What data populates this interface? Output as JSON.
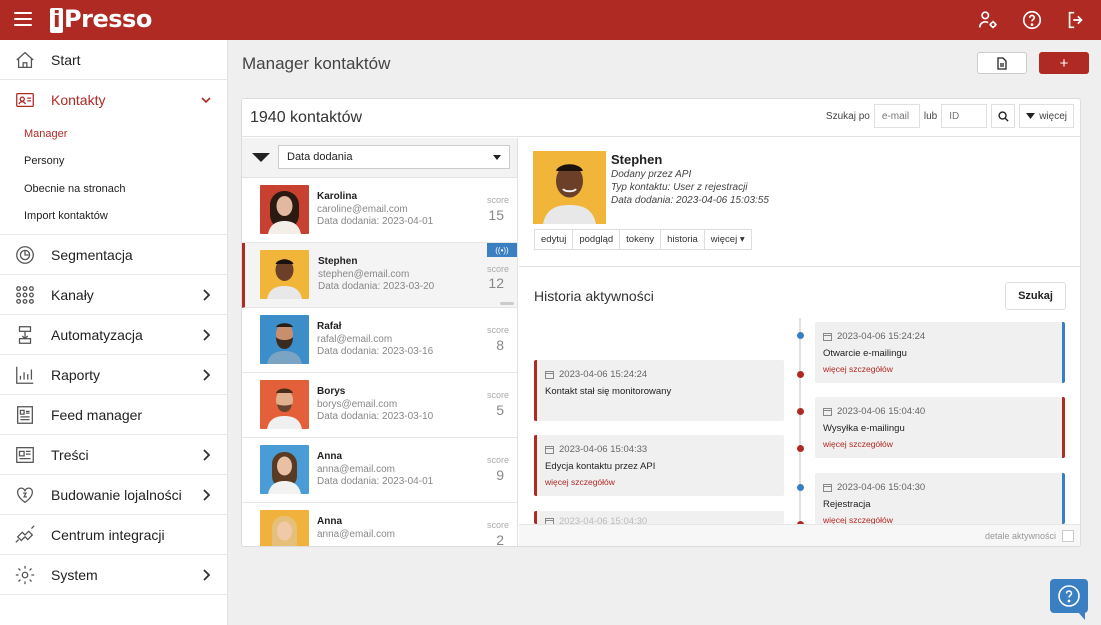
{
  "app": {
    "logo_i": "i",
    "logo_rest": "Presso"
  },
  "colors": {
    "brand": "#b02a24",
    "accent_blue": "#3a7fc1"
  },
  "topbar": {
    "icons": [
      "menu-icon",
      "user-settings-icon",
      "help-icon",
      "logout-icon"
    ]
  },
  "sidebar": {
    "items": [
      {
        "label": "Start",
        "icon": "home-icon"
      },
      {
        "label": "Kontakty",
        "icon": "contacts-icon",
        "active": true
      },
      {
        "label": "Segmentacja",
        "icon": "segmentation-icon"
      },
      {
        "label": "Kanały",
        "icon": "channels-icon"
      },
      {
        "label": "Automatyzacja",
        "icon": "automation-icon"
      },
      {
        "label": "Raporty",
        "icon": "reports-icon"
      },
      {
        "label": "Feed manager",
        "icon": "feed-icon"
      },
      {
        "label": "Treści",
        "icon": "content-icon"
      },
      {
        "label": "Budowanie lojalności",
        "icon": "loyalty-icon"
      },
      {
        "label": "Centrum integracji",
        "icon": "integration-icon"
      },
      {
        "label": "System",
        "icon": "gear-icon"
      }
    ],
    "sub_items": [
      "Manager",
      "Persony",
      "Obecnie na stronach",
      "Import kontaktów"
    ]
  },
  "page": {
    "title": "Manager kontaktów",
    "add_label": "+"
  },
  "card": {
    "count": "1940 kontaktów",
    "search": {
      "by_label": "Szukaj po",
      "email_placeholder": "e-mail",
      "or_label": "lub",
      "id_placeholder": "ID",
      "more_label": "więcej"
    }
  },
  "list": {
    "sort_label": "Data dodania",
    "contacts": [
      {
        "name": "Karolina",
        "email": "caroline@email.com",
        "date": "Data dodania: 2023-04-01",
        "score_label": "score",
        "score": "15"
      },
      {
        "name": "Stephen",
        "email": "stephen@email.com",
        "date": "Data dodania: 2023-03-20",
        "score_label": "score",
        "score": "12",
        "live": "((•))"
      },
      {
        "name": "Rafał",
        "email": "rafal@email.com",
        "date": "Data dodania: 2023-03-16",
        "score_label": "score",
        "score": "8"
      },
      {
        "name": "Borys",
        "email": "borys@email.com",
        "date": "Data dodania: 2023-03-10",
        "score_label": "score",
        "score": "5"
      },
      {
        "name": "Anna",
        "email": "anna@email.com",
        "date": "Data dodania: 2023-04-01",
        "score_label": "score",
        "score": "9"
      },
      {
        "name": "Anna",
        "email": "anna@email.com",
        "date": "",
        "score_label": "score",
        "score": "2"
      }
    ]
  },
  "detail": {
    "name": "Stephen",
    "added_by": "Dodany przez API",
    "type": "Typ kontaktu: User z rejestracji",
    "date": "Data dodania: 2023-04-06 15:03:55",
    "actions": [
      "edytuj",
      "podgląd",
      "tokeny",
      "historia",
      "więcej ▾"
    ],
    "history_title": "Historia aktywności",
    "search_btn": "Szukaj",
    "events_left": [
      {
        "date": "2023-04-06 15:24:24",
        "text": "Kontakt stał się monitorowany",
        "link": ""
      },
      {
        "date": "2023-04-06 15:04:33",
        "text": "Edycja kontaktu przez API",
        "link": "więcej szczegółów"
      },
      {
        "date": "2023-04-06 15:04:30",
        "text": "",
        "link": ""
      }
    ],
    "events_right": [
      {
        "date": "2023-04-06 15:24:24",
        "text": "Otwarcie e-mailingu",
        "link": "więcej szczegółów"
      },
      {
        "date": "2023-04-06 15:04:40",
        "text": "Wysyłka e-mailingu",
        "link": "więcej szczegółów"
      },
      {
        "date": "2023-04-06 15:04:30",
        "text": "Rejestracja",
        "link": "więcej szczegółów"
      }
    ],
    "footer_label": "detale aktywności"
  }
}
